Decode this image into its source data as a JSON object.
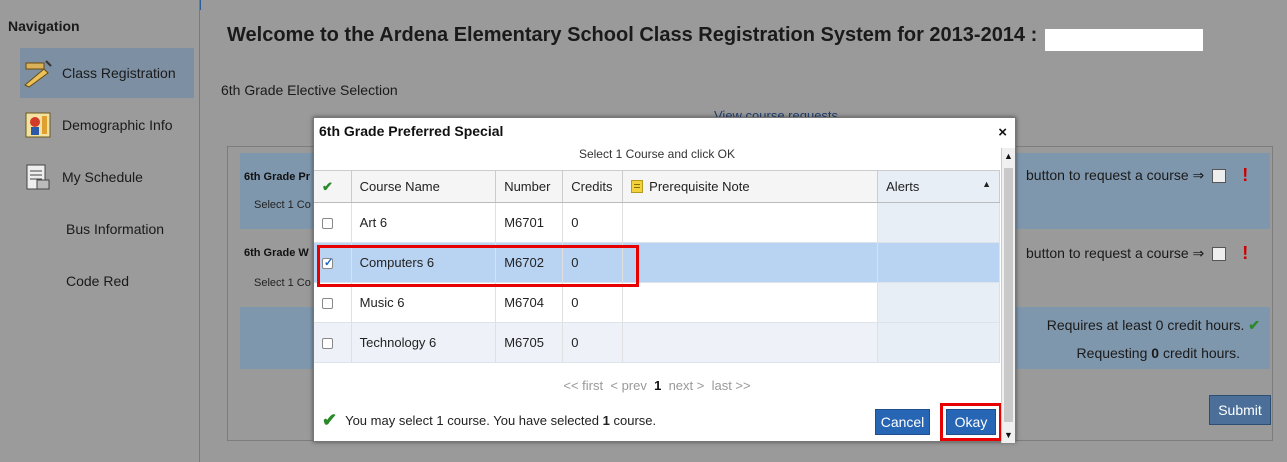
{
  "sidebar": {
    "title": "Navigation",
    "items": [
      {
        "label": "Class Registration",
        "icon": "class-registration-icon",
        "active": true
      },
      {
        "label": "Demographic Info",
        "icon": "demographic-icon"
      },
      {
        "label": "My Schedule",
        "icon": "schedule-icon"
      },
      {
        "label": "Bus Information"
      },
      {
        "label": "Code Red"
      }
    ]
  },
  "main": {
    "title": "Welcome to the Ardena Elementary School Class Registration System for 2013-2014 :",
    "subtitle": "6th Grade Elective Selection",
    "view_link": "View course requests",
    "requests": [
      {
        "name": "6th Grade Pr",
        "select_text": "Select 1 Co",
        "action": "button to request a course ⇒"
      },
      {
        "name": "6th Grade W",
        "select_text": "Select 1 Co",
        "action": "button to request a course ⇒"
      }
    ],
    "summary": {
      "requires": "Requires at least 0 credit hours.",
      "requesting_prefix": "Requesting",
      "requesting_value": "0",
      "requesting_suffix": "credit hours."
    },
    "submit_label": "Submit"
  },
  "modal": {
    "title": "6th Grade Preferred Special",
    "close": "×",
    "hint": "Select 1 Course and click OK",
    "columns": {
      "name": "Course Name",
      "number": "Number",
      "credits": "Credits",
      "note": "Prerequisite Note",
      "alerts": "Alerts"
    },
    "courses": [
      {
        "name": "Art 6",
        "number": "M6701",
        "credits": "0",
        "selected": false
      },
      {
        "name": "Computers 6",
        "number": "M6702",
        "credits": "0",
        "selected": true
      },
      {
        "name": "Music 6",
        "number": "M6704",
        "credits": "0",
        "selected": false
      },
      {
        "name": "Technology 6",
        "number": "M6705",
        "credits": "0",
        "selected": false
      }
    ],
    "pager": {
      "first": "<< first",
      "prev": "< prev",
      "current": "1",
      "next": "next >",
      "last": "last >>"
    },
    "status_prefix": "You may select 1 course. You have selected",
    "status_count": "1",
    "status_suffix": "course.",
    "cancel_label": "Cancel",
    "okay_label": "Okay"
  },
  "colors": {
    "accent": "#2766b4",
    "selected_row": "#b9d3f3",
    "highlight": "#e60000",
    "alert": "#cc0000",
    "ok": "#2a8a2a"
  }
}
